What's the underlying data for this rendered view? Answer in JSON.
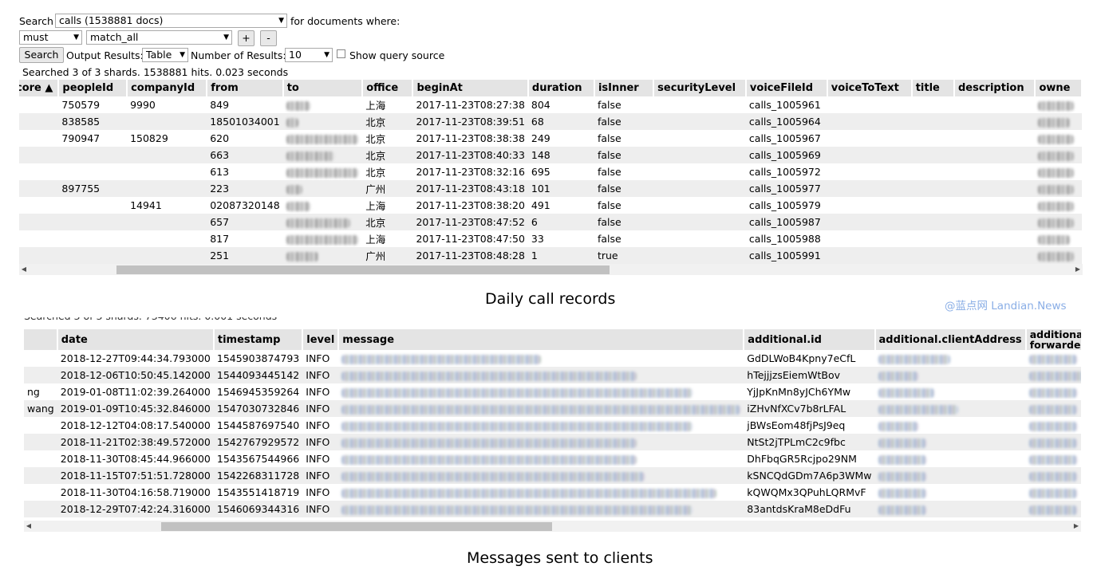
{
  "search": {
    "label": "Search",
    "index_select": "calls (1538881 docs)",
    "for_docs": "for documents where:",
    "bool_select": "must",
    "query_select": "match_all",
    "plus": "+",
    "minus": "-",
    "search_button": "Search",
    "output_label": "Output Results:",
    "output_select": "Table",
    "num_label": "Number of Results:",
    "num_select": "10",
    "show_query_source": "Show query source",
    "summary": "Searched 3 of 3 shards. 1538881 hits. 0.023 seconds"
  },
  "calls_table": {
    "columns": [
      "core ▲",
      "peopleId",
      "companyId",
      "from",
      "to",
      "office",
      "beginAt",
      "duration",
      "isInner",
      "securityLevel",
      "voiceFileId",
      "voiceToText",
      "title",
      "description",
      "owne"
    ],
    "rows": [
      [
        "",
        "750579",
        "9990",
        "849",
        "",
        "上海",
        "2017-11-23T08:27:38",
        "804",
        "false",
        "",
        "calls_1005961",
        "",
        "",
        "",
        ""
      ],
      [
        "",
        "838585",
        "",
        "18501034001",
        "",
        "北京",
        "2017-11-23T08:39:51",
        "68",
        "false",
        "",
        "calls_1005964",
        "",
        "",
        "",
        ""
      ],
      [
        "",
        "790947",
        "150829",
        "620",
        "",
        "北京",
        "2017-11-23T08:38:38",
        "249",
        "false",
        "",
        "calls_1005967",
        "",
        "",
        "",
        ""
      ],
      [
        "",
        "",
        "",
        "663",
        "",
        "北京",
        "2017-11-23T08:40:33",
        "148",
        "false",
        "",
        "calls_1005969",
        "",
        "",
        "",
        ""
      ],
      [
        "",
        "",
        "",
        "613",
        "",
        "北京",
        "2017-11-23T08:32:16",
        "695",
        "false",
        "",
        "calls_1005972",
        "",
        "",
        "",
        ""
      ],
      [
        "",
        "897755",
        "",
        "223",
        "",
        "广州",
        "2017-11-23T08:43:18",
        "101",
        "false",
        "",
        "calls_1005977",
        "",
        "",
        "",
        ""
      ],
      [
        "",
        "",
        "14941",
        "02087320148",
        "",
        "上海",
        "2017-11-23T08:38:20",
        "491",
        "false",
        "",
        "calls_1005979",
        "",
        "",
        "",
        ""
      ],
      [
        "",
        "",
        "",
        "657",
        "",
        "北京",
        "2017-11-23T08:47:52",
        "6",
        "false",
        "",
        "calls_1005987",
        "",
        "",
        "",
        ""
      ],
      [
        "",
        "",
        "",
        "817",
        "",
        "上海",
        "2017-11-23T08:47:50",
        "33",
        "false",
        "",
        "calls_1005988",
        "",
        "",
        "",
        ""
      ],
      [
        "",
        "",
        "",
        "251",
        "",
        "广州",
        "2017-11-23T08:48:28",
        "1",
        "true",
        "",
        "calls_1005991",
        "",
        "",
        "",
        ""
      ]
    ]
  },
  "caption_top": "Daily call records",
  "watermark": "@蓝点网 Landian.News",
  "messages_table": {
    "columns": [
      "",
      "date",
      "timestamp",
      "level",
      "message",
      "additional.id",
      "additional.clientAddress",
      "additional.\nforwarded"
    ],
    "rows": [
      [
        "",
        "2018-12-27T09:44:34.793000",
        "1545903874793",
        "INFO",
        "",
        "GdDLWoB4Kpny7eCfL",
        "",
        ""
      ],
      [
        "",
        "2018-12-06T10:50:45.142000",
        "1544093445142",
        "INFO",
        "",
        "hTejjjzsEiemWtBov",
        "",
        ""
      ],
      [
        "ng",
        "2019-01-08T11:02:39.264000",
        "1546945359264",
        "INFO",
        "",
        "YjJpKnMn8yJCh6YMw",
        "",
        ""
      ],
      [
        "wang",
        "2019-01-09T10:45:32.846000",
        "1547030732846",
        "INFO",
        "",
        "iZHvNfXCv7b8rLFAL",
        "",
        ""
      ],
      [
        "",
        "2018-12-12T04:08:17.540000",
        "1544587697540",
        "INFO",
        "",
        "jBWsEom48fjPsJ9eq",
        "",
        ""
      ],
      [
        "",
        "2018-11-21T02:38:49.572000",
        "1542767929572",
        "INFO",
        "",
        "NtSt2jTPLmC2c9fbc",
        "",
        ""
      ],
      [
        "",
        "2018-11-30T08:45:44.966000",
        "1543567544966",
        "INFO",
        "",
        "DhFbqGR5Rcjpo29NM",
        "",
        ""
      ],
      [
        "",
        "2018-11-15T07:51:51.728000",
        "1542268311728",
        "INFO",
        "",
        "kSNCQdGDm7A6p3WMw",
        "",
        ""
      ],
      [
        "",
        "2018-11-30T04:16:58.719000",
        "1543551418719",
        "INFO",
        "",
        "kQWQMx3QPuhLQRMvF",
        "",
        ""
      ],
      [
        "",
        "2018-12-29T07:42:24.316000",
        "1546069344316",
        "INFO",
        "",
        "83antdsKraM8eDdFu",
        "",
        ""
      ]
    ]
  },
  "caption_bottom": "Messages sent to clients"
}
